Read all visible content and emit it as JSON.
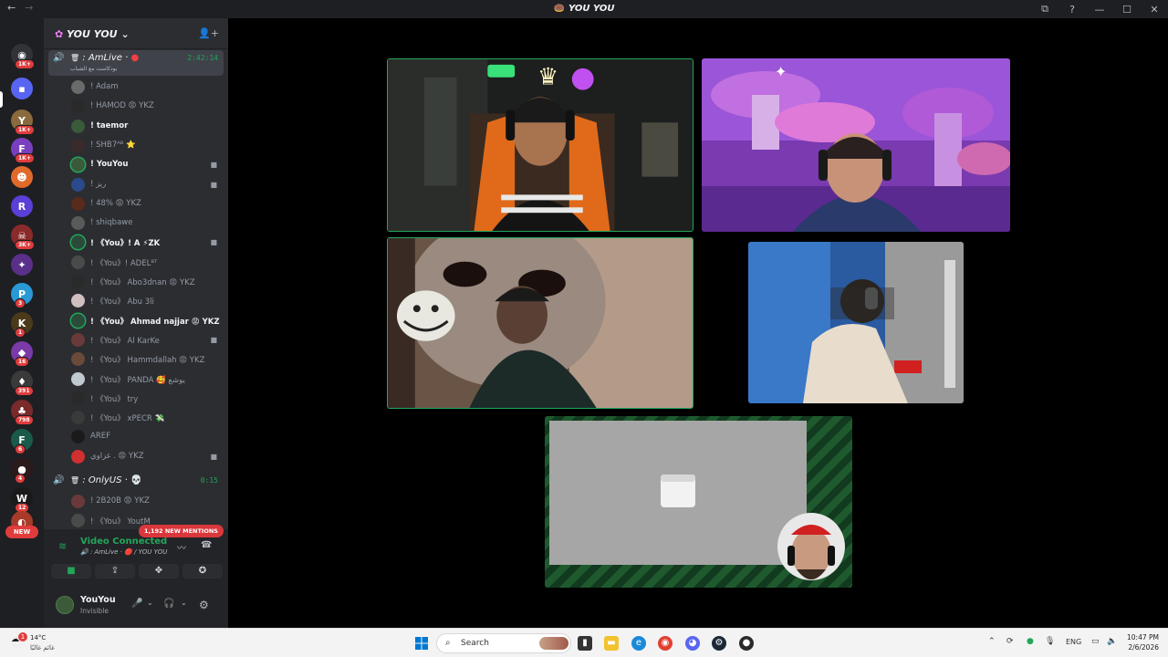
{
  "window": {
    "title": "YOU YOU",
    "nav_back": "←",
    "nav_forward": "→",
    "title_icon": "🍩",
    "controls": [
      "⧉",
      "?",
      "—",
      "☐",
      "✕"
    ]
  },
  "guild_rail": {
    "items": [
      {
        "glyph": "◉",
        "color": "#313338",
        "badge": "1K+"
      },
      {
        "glyph": "▪",
        "color": "#5865f2",
        "badge": ""
      },
      {
        "glyph": "Y",
        "color": "#8a6a3c",
        "badge": "1K+"
      },
      {
        "glyph": "F",
        "color": "#7a3fbf",
        "badge": "1K+"
      },
      {
        "glyph": "☻",
        "color": "#e06a2a",
        "badge": ""
      },
      {
        "glyph": "R",
        "color": "#5b3fd6",
        "badge": ""
      },
      {
        "glyph": "☠",
        "color": "#8a2a2a",
        "badge": "3K+"
      },
      {
        "glyph": "✦",
        "color": "#5a2f8a",
        "badge": ""
      },
      {
        "glyph": "P",
        "color": "#2a9ad6",
        "badge": "3"
      },
      {
        "glyph": "K",
        "color": "#4a3a1a",
        "badge": "1"
      },
      {
        "glyph": "◆",
        "color": "#7a3aa8",
        "badge": "16"
      },
      {
        "glyph": "♦",
        "color": "#3a3a3a",
        "badge": "391"
      },
      {
        "glyph": "♣",
        "color": "#7a2a2a",
        "badge": "798"
      },
      {
        "glyph": "F",
        "color": "#1a5a4a",
        "badge": "6"
      },
      {
        "glyph": "●",
        "color": "#2a1a1a",
        "badge": "4"
      },
      {
        "glyph": "W",
        "color": "#1a1a1a",
        "badge": "12"
      },
      {
        "glyph": "◐",
        "color": "#a83a2a",
        "badge": ""
      }
    ],
    "new_label": "NEW"
  },
  "sidebar": {
    "server_name": "YOU YOU",
    "server_icon": "✿",
    "chevron": "⌄",
    "add_member_icon": "👤+",
    "channels": [
      {
        "name": "AmLive",
        "subtitle": "بودكاست مع الشباب",
        "time": "2:42:14",
        "speaker_icon": "🔊",
        "trash_icon": "🗑",
        "members": [
          {
            "name": "! Adam",
            "color": "#6a6a6a",
            "speaking": false,
            "bright": false,
            "cam": false
          },
          {
            "name": "! HAMOD 😡 YKZ",
            "color": "#2a2a2a",
            "speaking": false,
            "bright": false,
            "cam": false
          },
          {
            "name": "! taemor",
            "color": "#3a5a3a",
            "speaking": false,
            "bright": true,
            "cam": false
          },
          {
            "name": "! SHB7ᴬᴮ ⭐",
            "color": "#3a2a2a",
            "speaking": false,
            "bright": false,
            "cam": false
          },
          {
            "name": "! YouYou",
            "color": "#3b5a3a",
            "speaking": true,
            "bright": true,
            "cam": true
          },
          {
            "name": "! ريز",
            "color": "#2a4a8a",
            "speaking": false,
            "bright": false,
            "cam": true
          },
          {
            "name": "! 48% 😡 YKZ",
            "color": "#5a2a1a",
            "speaking": false,
            "bright": false,
            "cam": false
          },
          {
            "name": "! shiqbawe",
            "color": "#5a5a5a",
            "speaking": false,
            "bright": false,
            "cam": false
          },
          {
            "name": "! 《You》! A ⚡ZK",
            "color": "#2a4a3a",
            "speaking": true,
            "bright": true,
            "cam": true
          },
          {
            "name": "! 《You》! ADELᴮᵀ",
            "color": "#4a4a4a",
            "speaking": false,
            "bright": false,
            "cam": false
          },
          {
            "name": "! 《You》 Abo3dnan 😡 YKZ",
            "color": "#2a2a2a",
            "speaking": false,
            "bright": false,
            "cam": false
          },
          {
            "name": "! 《You》 Abu 3li",
            "color": "#d0c0c0",
            "speaking": false,
            "bright": false,
            "cam": false
          },
          {
            "name": "! 《You》 Ahmad najjar 😡 YKZ",
            "color": "#2a4a3a",
            "speaking": true,
            "bright": true,
            "cam": false
          },
          {
            "name": "! 《You》 Al KarKe",
            "color": "#6a3a3a",
            "speaking": false,
            "bright": false,
            "cam": true
          },
          {
            "name": "! 《You》 Hammdallah 😡 YKZ",
            "color": "#6a4a3a",
            "speaking": false,
            "bright": false,
            "cam": false
          },
          {
            "name": "! 《You》 PANDA 🥰 يوشع",
            "color": "#c0c8d0",
            "speaking": false,
            "bright": false,
            "cam": false
          },
          {
            "name": "! 《You》 try",
            "color": "#2a2a2a",
            "speaking": false,
            "bright": false,
            "cam": false
          },
          {
            "name": "! 《You》 xPECR 💸",
            "color": "#3a3a3a",
            "speaking": false,
            "bright": false,
            "cam": false
          },
          {
            "name": "AREF",
            "color": "#1a1a1a",
            "speaking": false,
            "bright": false,
            "cam": false
          },
          {
            "name": "غزاوي . 😡 YKZ",
            "color": "#d03030",
            "speaking": false,
            "bright": false,
            "cam": true
          }
        ]
      },
      {
        "name": "OnlyUS",
        "time": "0:15",
        "skull": "💀",
        "members": [
          {
            "name": "! 2B20B 😡 YKZ",
            "color": "#6a3a3a"
          },
          {
            "name": "! 《You》 YoutM",
            "color": "#4a4a4a"
          }
        ]
      }
    ],
    "mentions_label": "1,192 NEW MENTIONS"
  },
  "voice_panel": {
    "status": "Video Connected",
    "location": "🔊 : AmLive · 🔴 / YOU YOU",
    "noise_icon": "〰",
    "disconnect_icon": "☎",
    "actions": [
      {
        "name": "camera",
        "glyph": "■"
      },
      {
        "name": "screen-share",
        "glyph": "⇪"
      },
      {
        "name": "activities",
        "glyph": "✥"
      },
      {
        "name": "soundboard",
        "glyph": "✪"
      }
    ]
  },
  "user_panel": {
    "username": "YouYou",
    "status": "Invisible",
    "mic_icon": "🎤",
    "headset_icon": "🎧",
    "settings_icon": "⚙",
    "chevron": "⌄"
  },
  "stage": {
    "tiles": [
      {
        "id": "tile-1",
        "speaking": true
      },
      {
        "id": "tile-2",
        "speaking": false
      },
      {
        "id": "tile-3",
        "speaking": true
      },
      {
        "id": "tile-4",
        "speaking": false
      },
      {
        "id": "tile-5",
        "speaking": false
      }
    ]
  },
  "taskbar": {
    "temperature": "14°C",
    "weather_desc": "غائم غالبًا",
    "weather_badge": "1",
    "search_label": "Search",
    "search_icon": "⌕",
    "language": "ENG",
    "time": "10:47 PM",
    "date": "2/6/2026",
    "tray_chevron": "⌃"
  }
}
